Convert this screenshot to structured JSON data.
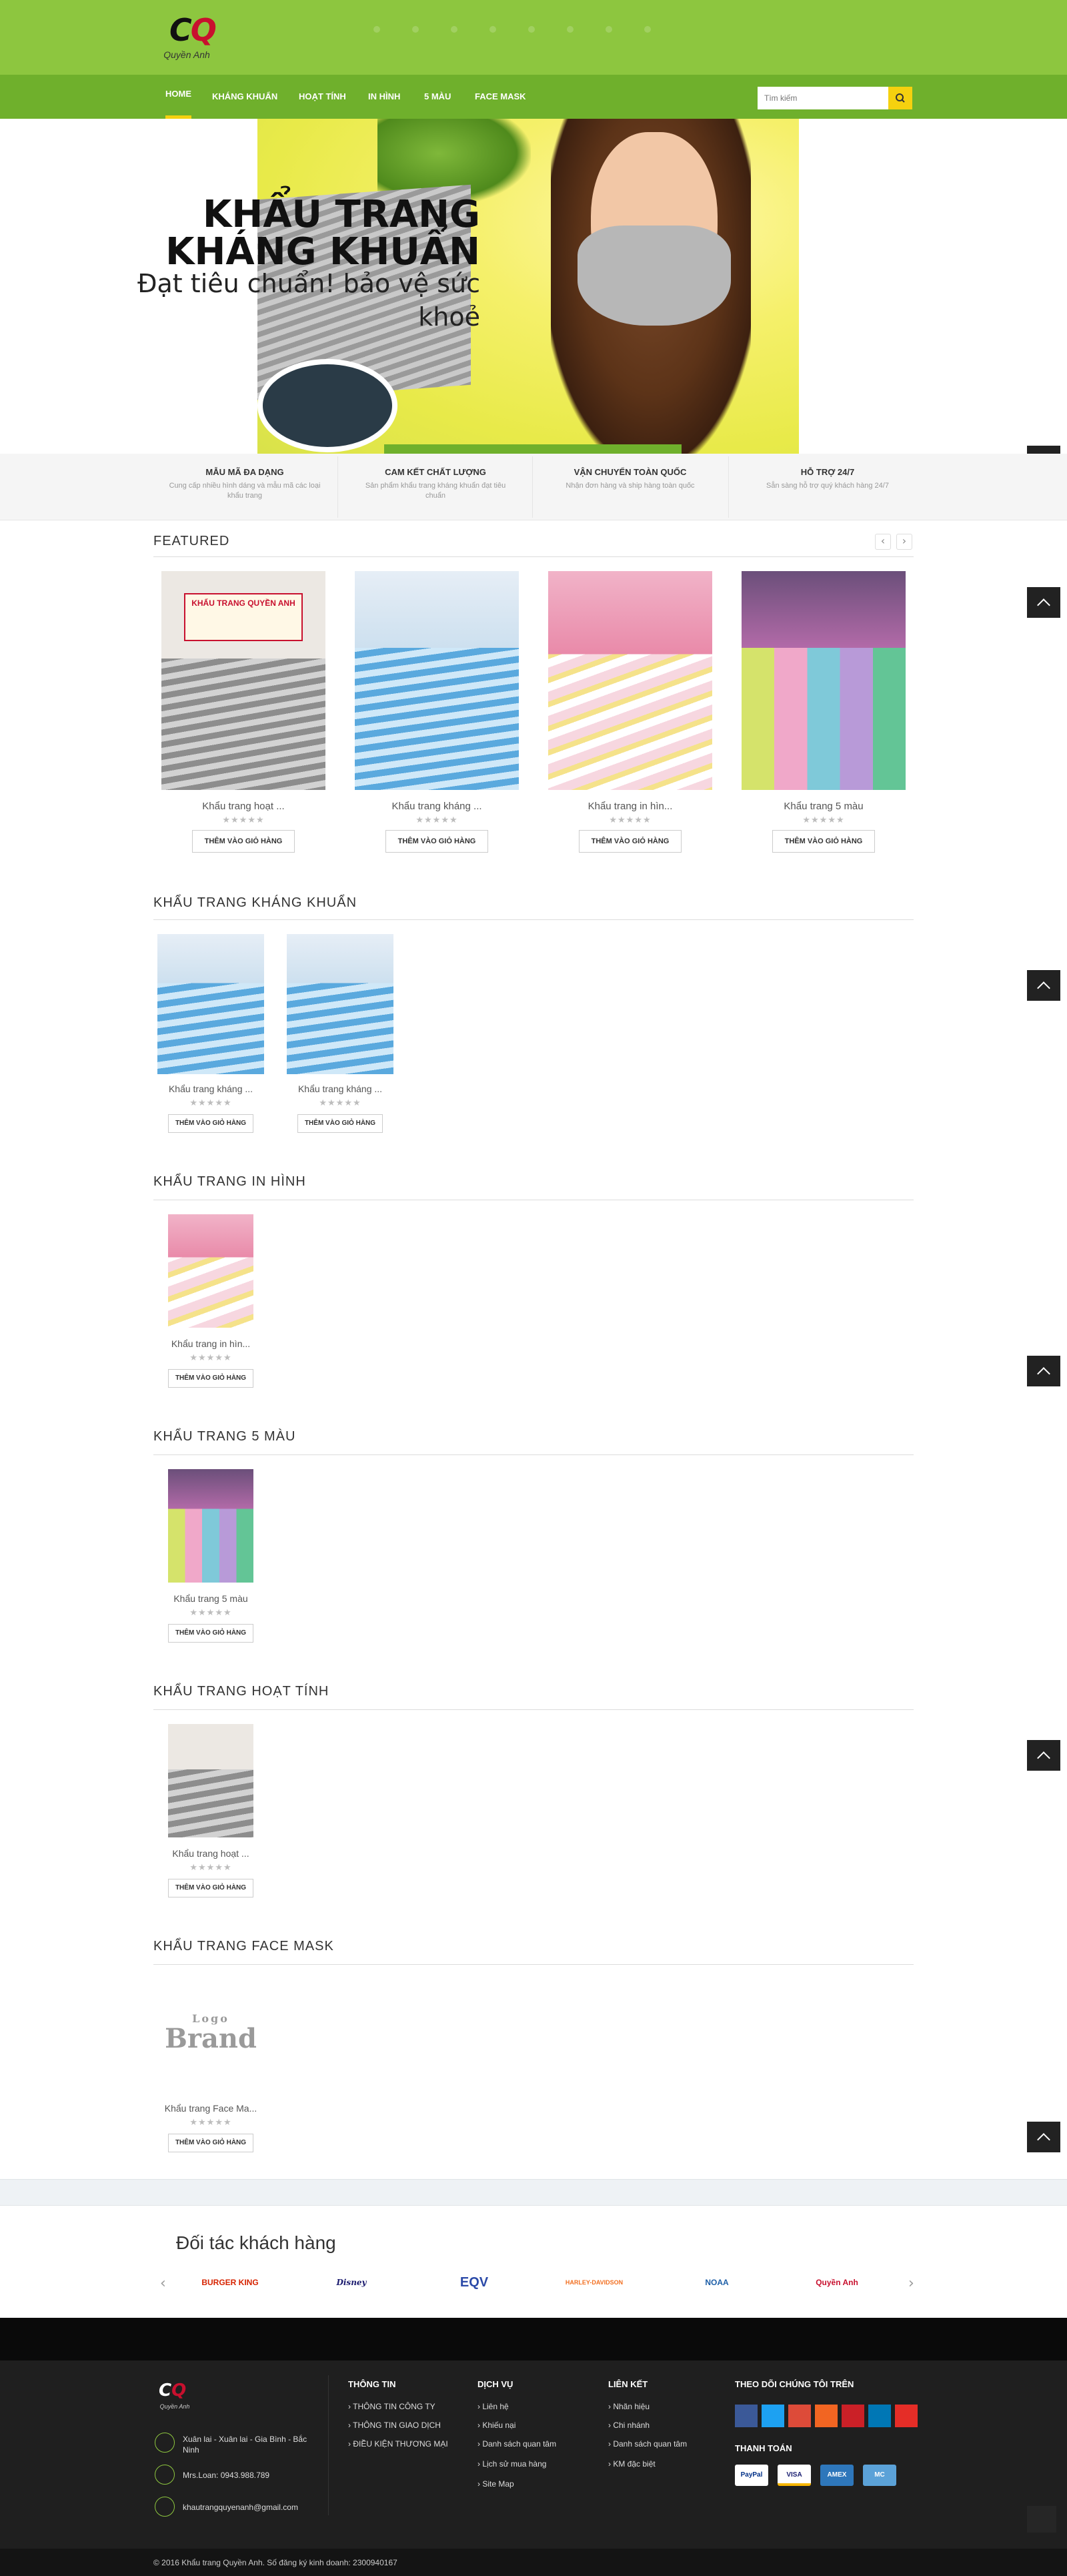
{
  "site": {
    "logo_text": "Quyền Anh",
    "logo_mark_a": "C",
    "logo_mark_b": "Q"
  },
  "nav": {
    "items": [
      "HOME",
      "KHÁNG KHUẨN",
      "HOẠT TÍNH",
      "IN HÌNH",
      "5 MÀU",
      "FACE MASK"
    ],
    "active_index": 0
  },
  "search": {
    "placeholder": "Tìm kiếm",
    "icon": "search-icon"
  },
  "hero": {
    "title_line1": "KHẨU TRANG",
    "title_line2": "KHÁNG KHUẨN",
    "subtitle": "Đạt tiêu chuẩn! bảo vệ sức khoẻ"
  },
  "features": [
    {
      "title": "MẪU MÃ ĐA DẠNG",
      "desc": "Cung cấp nhiều hình dáng và mẫu mã các loại khẩu trang"
    },
    {
      "title": "CAM KẾT CHẤT LƯỢNG",
      "desc": "Sản phẩm khẩu trang kháng khuẩn đạt tiêu chuẩn"
    },
    {
      "title": "VẬN CHUYỂN TOÀN QUỐC",
      "desc": "Nhận đơn hàng và ship hàng toàn quốc"
    },
    {
      "title": "HỖ TRỢ 24/7",
      "desc": "Sẵn sàng hỗ trợ quý khách hàng 24/7"
    }
  ],
  "cart_label": "THÊM VÀO GIỎ HÀNG",
  "stars": "★★★★★",
  "sections": {
    "featured": {
      "title": "FEATURED",
      "items": [
        "Khẩu trang hoạt ...",
        "Khẩu trang kháng ...",
        "Khẩu trang in hìn...",
        "Khẩu trang 5 màu"
      ]
    },
    "khang_khuan": {
      "title": "KHẨU TRANG KHÁNG KHUẨN",
      "items": [
        "Khẩu trang kháng ...",
        "Khẩu trang kháng ..."
      ]
    },
    "in_hinh": {
      "title": "KHẨU TRANG IN HÌNH",
      "items": [
        "Khẩu trang in hìn..."
      ]
    },
    "five_colors": {
      "title": "KHẨU TRANG 5 MÀU",
      "items": [
        "Khẩu trang 5 màu"
      ]
    },
    "hoat_tinh": {
      "title": "KHẨU TRANG HOẠT TÍNH",
      "items": [
        "Khẩu trang hoạt ..."
      ]
    },
    "face_mask": {
      "title": "KHẨU TRANG FACE MASK",
      "items": [
        "Khẩu trang Face Ma..."
      ],
      "placeholder_logo_top": "Logo",
      "placeholder_logo_bottom": "Brand"
    }
  },
  "box_label": "KHẨU TRANG QUYỀN ANH",
  "partners": {
    "title": "Đối tác khách hàng",
    "logos": [
      "BURGER KING",
      "Disney",
      "EQV",
      "HARLEY-DAVIDSON",
      "NOAA",
      "Quyền Anh"
    ]
  },
  "footer": {
    "address": "Xuân lai - Xuân lai - Gia Bình - Bắc Ninh",
    "phone": "Mrs.Loan: 0943.988.789",
    "email": "khautrangquyenanh@gmail.com",
    "columns": [
      {
        "title": "THÔNG TIN",
        "links": [
          "THÔNG TIN CÔNG TY",
          "THÔNG TIN GIAO DỊCH",
          "ĐIỀU KIỆN THƯƠNG MẠI"
        ]
      },
      {
        "title": "DỊCH VỤ",
        "links": [
          "Liên hệ",
          "Khiếu nại",
          "Danh sách quan tâm",
          "Lịch sử mua hàng",
          "Site Map"
        ]
      },
      {
        "title": "LIÊN KẾT",
        "links": [
          "Nhãn hiệu",
          "Chi nhánh",
          "Danh sách quan tâm",
          "KM đặc biệt"
        ]
      }
    ],
    "follow_title": "THEO DÕI CHÚNG TÔI TRÊN",
    "social": [
      "f",
      "t",
      "g+",
      "rss",
      "p",
      "in",
      "yt"
    ],
    "payment_title": "THANH TOÁN",
    "payments": [
      "PayPal",
      "VISA",
      "AMEX",
      "MC"
    ],
    "copyright": "© 2016 Khẩu trang Quyền Anh. Số đăng ký kinh doanh: 2300940167"
  },
  "colors": {
    "header_green": "#8dc63f",
    "nav_green": "#6fb02c",
    "accent_yellow": "#f5d10f",
    "footer_bg": "#1f1f1f"
  }
}
